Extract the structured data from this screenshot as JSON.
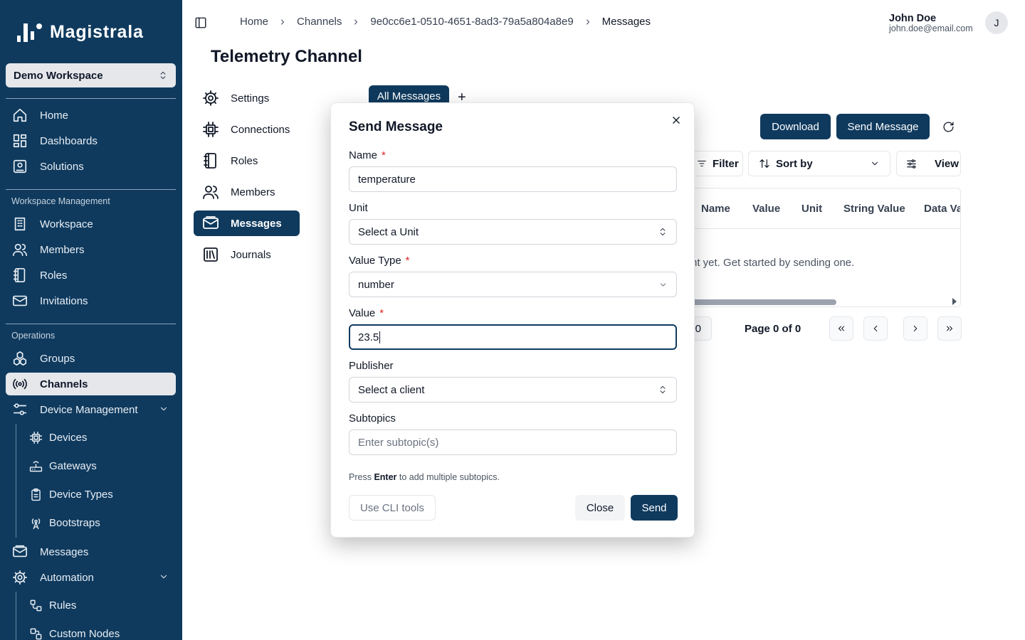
{
  "app": {
    "name": "Magistrala"
  },
  "workspace": {
    "selected": "Demo Workspace"
  },
  "sidebar": {
    "top_items": [
      {
        "label": "Home",
        "icon": "home-icon"
      },
      {
        "label": "Dashboards",
        "icon": "dashboard-icon"
      },
      {
        "label": "Solutions",
        "icon": "solutions-icon"
      }
    ],
    "workspace_section": "Workspace Management",
    "workspace_items": [
      {
        "label": "Workspace",
        "icon": "building-icon"
      },
      {
        "label": "Members",
        "icon": "users-icon"
      },
      {
        "label": "Roles",
        "icon": "roles-icon"
      },
      {
        "label": "Invitations",
        "icon": "mail-icon"
      }
    ],
    "operations_section": "Operations",
    "operations_items": [
      {
        "label": "Groups",
        "icon": "groups-icon"
      },
      {
        "label": "Channels",
        "icon": "broadcast-icon",
        "active": true
      },
      {
        "label": "Device Management",
        "icon": "sliders-icon"
      }
    ],
    "device_items": [
      {
        "label": "Devices",
        "icon": "cpu-icon"
      },
      {
        "label": "Gateways",
        "icon": "router-icon"
      },
      {
        "label": "Device Types",
        "icon": "clipboard-icon"
      },
      {
        "label": "Bootstraps",
        "icon": "antenna-icon"
      }
    ],
    "more_items": [
      {
        "label": "Messages",
        "icon": "mail-open-icon"
      },
      {
        "label": "Automation",
        "icon": "gear-icon"
      }
    ],
    "automation_items": [
      {
        "label": "Rules",
        "icon": "workflow-icon"
      },
      {
        "label": "Custom Nodes",
        "icon": "nodes-icon"
      }
    ]
  },
  "breadcrumbs": [
    "Home",
    "Channels",
    "9e0cc6e1-0510-4651-8ad3-79a5a804a8e9",
    "Messages"
  ],
  "user": {
    "name": "John Doe",
    "email": "john.doe@email.com",
    "initial": "J"
  },
  "page": {
    "title": "Telemetry Channel"
  },
  "channel_nav": [
    {
      "label": "Settings",
      "icon": "gear-icon"
    },
    {
      "label": "Connections",
      "icon": "cpu-icon"
    },
    {
      "label": "Roles",
      "icon": "roles-icon"
    },
    {
      "label": "Members",
      "icon": "users-icon"
    },
    {
      "label": "Messages",
      "icon": "mail-open-icon",
      "active": true
    },
    {
      "label": "Journals",
      "icon": "library-icon"
    }
  ],
  "tabs": {
    "active": "All Messages",
    "add": "+"
  },
  "toolbar": {
    "download": "Download",
    "send_message": "Send Message",
    "filter": "Filter",
    "sort_by": "Sort by",
    "view": "View"
  },
  "table": {
    "columns": [
      "Name",
      "Value",
      "Unit",
      "String Value",
      "Data Va"
    ],
    "empty_text": "nt yet. Get started by sending one."
  },
  "pagination": {
    "rows_value": "0",
    "page_text": "Page 0 of 0"
  },
  "modal": {
    "title": "Send Message",
    "name_label": "Name",
    "name_value": "temperature",
    "unit_label": "Unit",
    "unit_value": "Select a Unit",
    "value_type_label": "Value Type",
    "value_type_value": "number",
    "value_label": "Value",
    "value_value": "23.5",
    "publisher_label": "Publisher",
    "publisher_value": "Select a client",
    "subtopics_label": "Subtopics",
    "subtopics_placeholder": "Enter subtopic(s)",
    "hint_prefix": "Press ",
    "hint_key": "Enter",
    "hint_suffix": " to add multiple subtopics.",
    "cli_button": "Use CLI tools",
    "close_button": "Close",
    "send_button": "Send",
    "required_mark": "*"
  },
  "colors": {
    "sidebar_bg": "#0f3a5e",
    "primary": "#0f3a5e",
    "required": "#dc2626"
  }
}
